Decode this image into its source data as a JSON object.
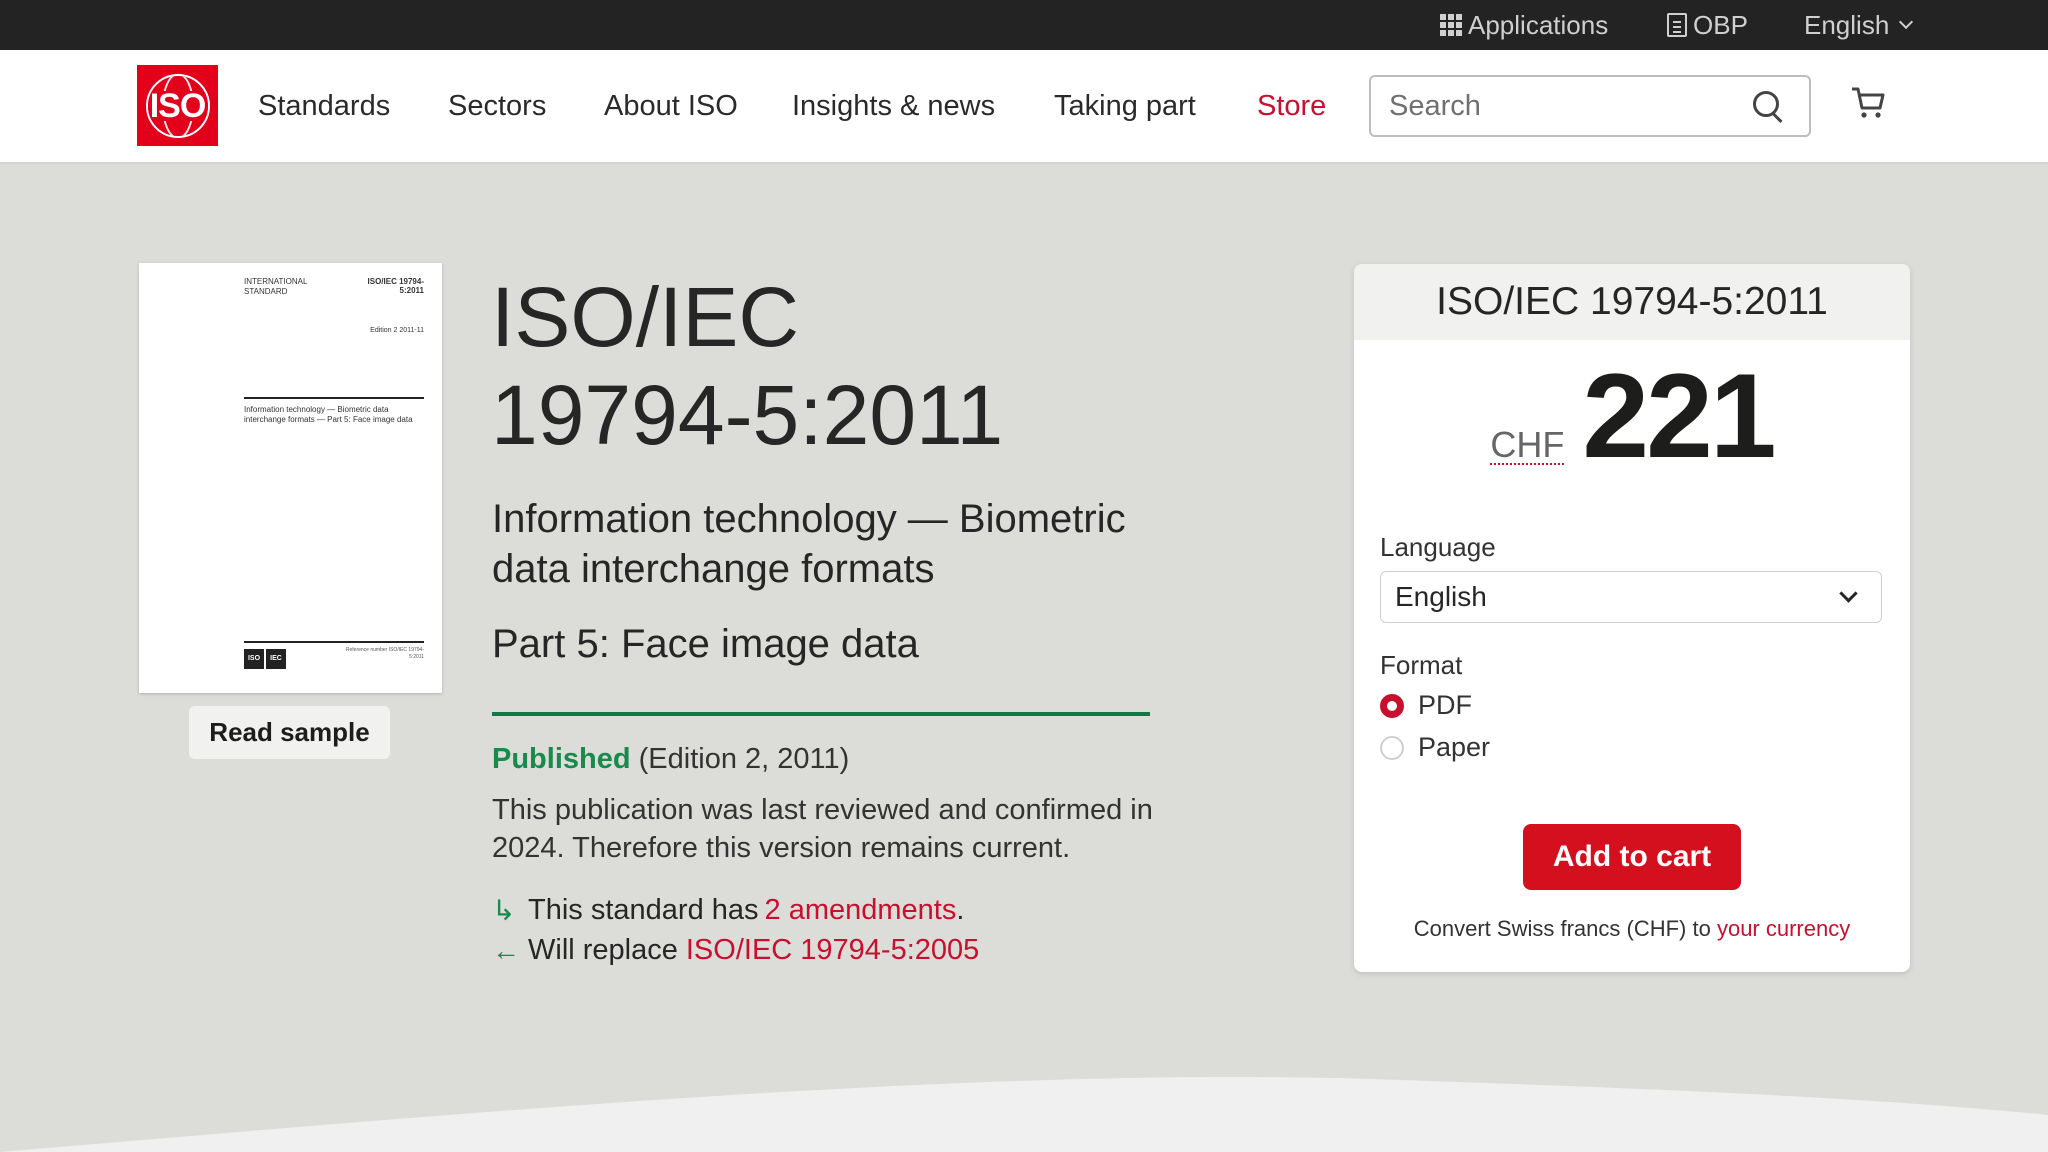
{
  "topbar": {
    "applications": "Applications",
    "obp": "OBP",
    "language": "English"
  },
  "nav": {
    "logo_text": "ISO",
    "links": [
      "Standards",
      "Sectors",
      "About ISO",
      "Insights & news",
      "Taking part",
      "Store"
    ],
    "search_placeholder": "Search"
  },
  "cover": {
    "type": "INTERNATIONAL STANDARD",
    "ref": "ISO/IEC 19794-5:2011",
    "edition": "Edition 2 2011-11",
    "title": "Information technology — Biometric data interchange formats — Part 5: Face image data",
    "logo_iso": "ISO",
    "logo_iec": "IEC",
    "footer": "Reference number ISO/IEC 19794-5:2011"
  },
  "read_sample": "Read sample",
  "standard": {
    "title": "ISO/IEC 19794-5:2011",
    "subtitle": "Information technology — Biometric data interchange formats",
    "part": "Part 5: Face image data",
    "status": "Published",
    "edition": "(Edition 2, 2011)",
    "reviewed": "This publication was last reviewed and confirmed in 2024. Therefore this version remains current.",
    "amend_prefix": "This standard has",
    "amend_link": "2 amendments",
    "amend_suffix": ".",
    "replace_prefix": "Will replace",
    "replace_link": "ISO/IEC 19794-5:2005"
  },
  "buy": {
    "title": "ISO/IEC 19794-5:2011",
    "currency": "CHF",
    "price": "221",
    "language_label": "Language",
    "language_value": "English",
    "format_label": "Format",
    "formats": [
      "PDF",
      "Paper"
    ],
    "selected_format": "PDF",
    "add_to_cart": "Add to cart",
    "convert_prefix": "Convert Swiss francs (CHF) to",
    "convert_link": "your currency"
  },
  "colors": {
    "brand_red": "#e2001a",
    "store_red": "#c8102e",
    "published_green": "#1a8a4c",
    "page_bg": "#dcdcd8",
    "topbar_bg": "#232323"
  }
}
